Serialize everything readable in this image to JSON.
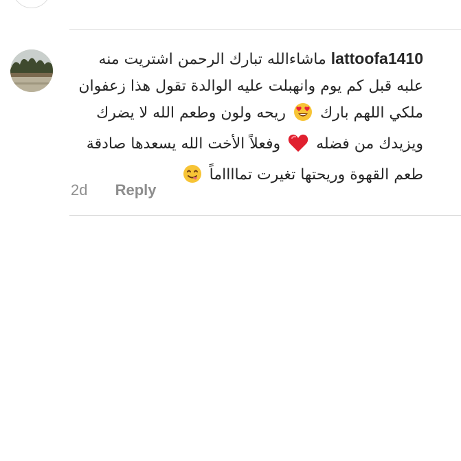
{
  "comment": {
    "username": "lattoofa1410",
    "line1": "ماشاءالله تبارك الرحمن اشتريت منه",
    "line2": "علبه قبل كم يوم وانهبلت عليه الوالدة تقول هذا زعفوان",
    "line3a": "ملكي اللهم بارك",
    "line3b": "ريحه ولون وطعم الله لا يضرك",
    "line4a": "ويزيدك من فضله",
    "line4b": "وفعلاً الأخت الله يسعدها صادقة",
    "line5": "طعم القهوة وريحتها تغيرت تمااااماً",
    "time": "2d",
    "reply_label": "Reply"
  },
  "icons": {
    "emoji_1": "heart-eyes-emoji-icon",
    "emoji_2": "red-heart-emoji-icon",
    "emoji_3": "savoring-food-emoji-icon"
  },
  "colors": {
    "text": "#262626",
    "meta": "#8e8e8e",
    "divider": "#dbdbdb",
    "heart": "#e0202f",
    "emoji_face": "#f7c436"
  }
}
